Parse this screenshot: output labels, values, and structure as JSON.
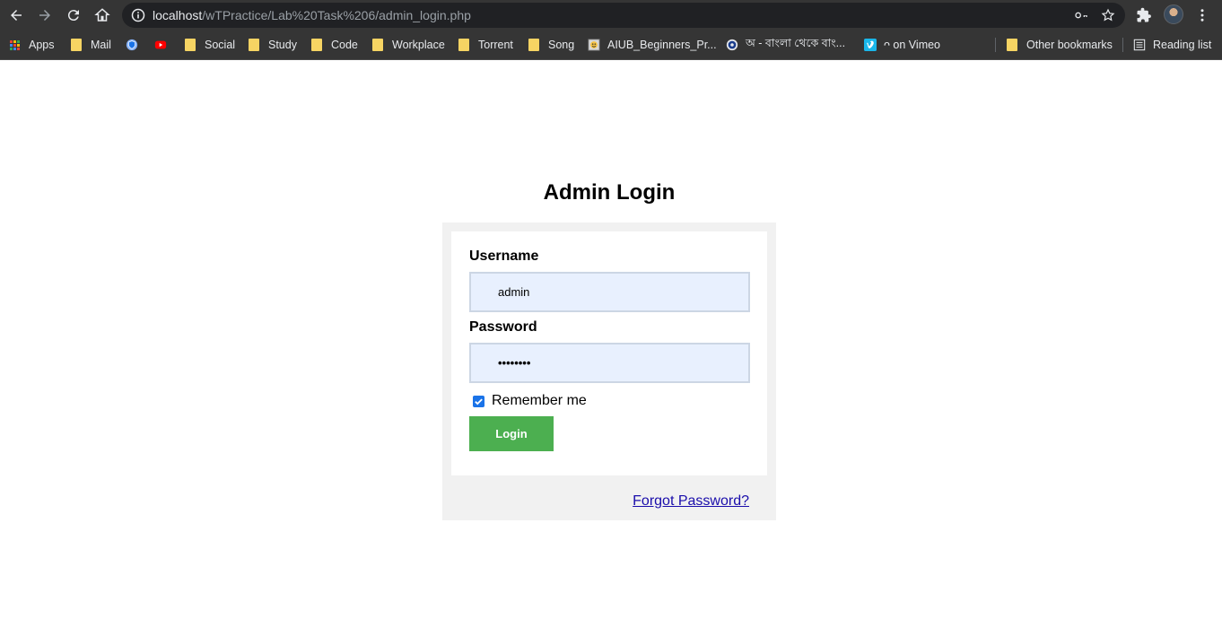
{
  "browser": {
    "url_host": "localhost",
    "url_path": "/wTPractice/Lab%20Task%206/admin_login.php",
    "bookmarks": [
      {
        "label": "Apps",
        "icon": "apps-grid-icon"
      },
      {
        "label": "Mail",
        "icon": "folder-icon"
      },
      {
        "label": "",
        "icon": "shield-icon"
      },
      {
        "label": "",
        "icon": "youtube-icon"
      },
      {
        "label": "Social",
        "icon": "folder-icon"
      },
      {
        "label": "Study",
        "icon": "folder-icon"
      },
      {
        "label": "Code",
        "icon": "folder-icon"
      },
      {
        "label": "Workplace",
        "icon": "folder-icon"
      },
      {
        "label": "Torrent",
        "icon": "folder-icon"
      },
      {
        "label": "Song",
        "icon": "folder-icon"
      },
      {
        "label": "AIUB_Beginners_Pr...",
        "icon": "site-icon"
      },
      {
        "label": "অ - বাংলা থেকে বাং...",
        "icon": "globe-icon"
      },
      {
        "label": "ᴖ on Vimeo",
        "icon": "vimeo-icon"
      },
      {
        "label": "Other bookmarks",
        "icon": "folder-icon"
      },
      {
        "label": "Reading list",
        "icon": "reading-list-icon"
      }
    ]
  },
  "login": {
    "title": "Admin Login",
    "username_label": "Username",
    "username_value": "admin",
    "password_label": "Password",
    "password_value": "••••••••",
    "remember_label": "Remember me",
    "remember_checked": true,
    "login_button": "Login",
    "forgot_link": "Forgot Password?"
  },
  "colors": {
    "chrome_bg": "#353535",
    "input_bg": "#e8f0fe",
    "button_green": "#4caf50",
    "link_blue": "#1a0dab",
    "box_bg": "#f1f1f1"
  }
}
